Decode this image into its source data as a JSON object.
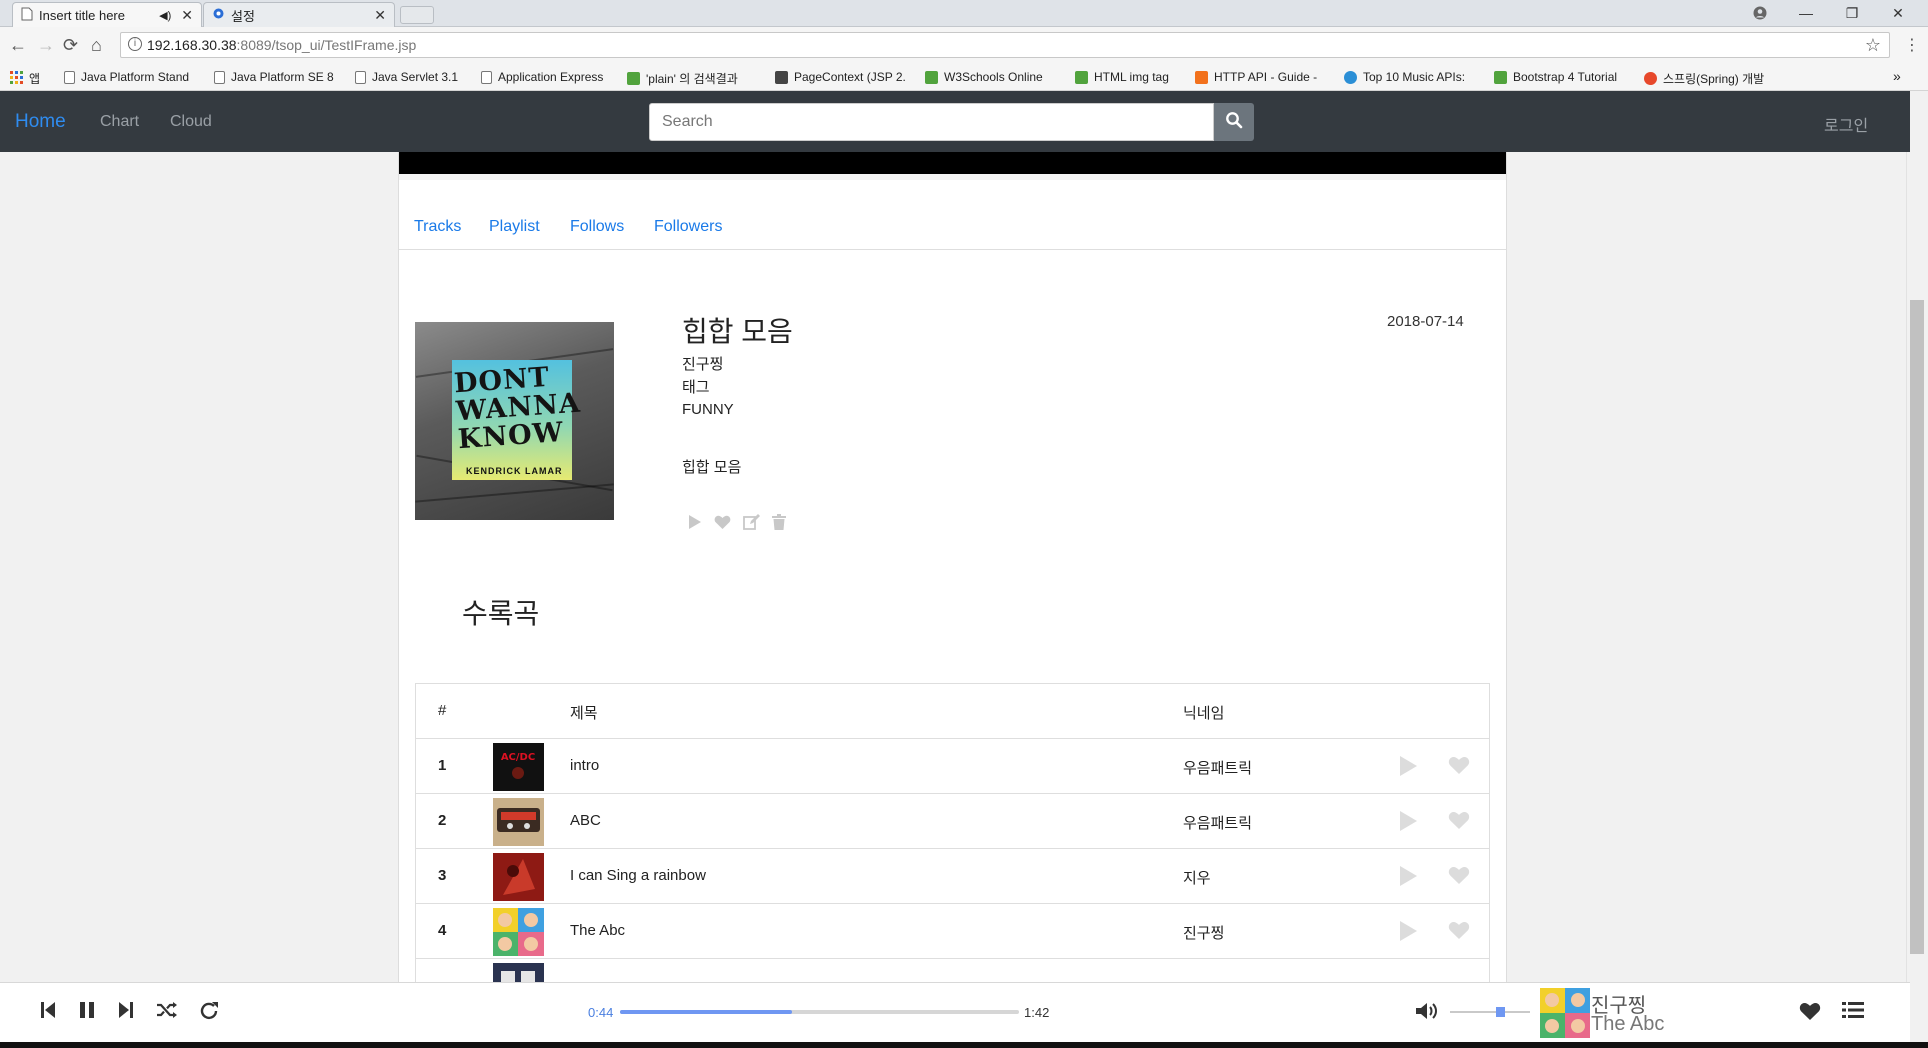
{
  "browser": {
    "tabs": [
      {
        "title": "Insert title here",
        "icon": "page-icon"
      },
      {
        "title": "설정",
        "icon": "gear-icon"
      }
    ],
    "url_host": "192.168.30.38",
    "url_path": ":8089/tsop_ui/TestIFrame.jsp",
    "bookmarks": [
      {
        "label": "앱",
        "icon": "apps-icon"
      },
      {
        "label": "Java Platform Stand",
        "icon": "page-icon"
      },
      {
        "label": "Java Platform SE 8",
        "icon": "page-icon"
      },
      {
        "label": "Java Servlet 3.1",
        "icon": "page-icon"
      },
      {
        "label": "Application Express",
        "icon": "page-icon"
      },
      {
        "label": "'plain' 의 검색결과",
        "icon": "naver-icon"
      },
      {
        "label": "PageContext (JSP 2.",
        "icon": "image-icon"
      },
      {
        "label": "W3Schools Online",
        "icon": "w3-icon"
      },
      {
        "label": "HTML img tag",
        "icon": "w3-icon"
      },
      {
        "label": "HTTP API - Guide -",
        "icon": "soundcloud-icon"
      },
      {
        "label": "Top 10 Music APIs:",
        "icon": "puzzle-icon"
      },
      {
        "label": "Bootstrap 4 Tutorial",
        "icon": "w3-icon"
      },
      {
        "label": "스프링(Spring) 개발",
        "icon": "tistory-icon"
      }
    ],
    "more_bookmarks": "»"
  },
  "navbar": {
    "brand": "Home",
    "links": [
      "Chart",
      "Cloud"
    ],
    "search_placeholder": "Search",
    "login": "로그인"
  },
  "profile_tabs": [
    "Tracks",
    "Playlist",
    "Follows",
    "Followers"
  ],
  "playlist": {
    "title": "힙합 모음",
    "date": "2018-07-14",
    "owner": "진구찡",
    "tag_label": "태그",
    "tag": "FUNNY",
    "description": "힙합 모음",
    "cover_text": "DONT WANNA KNOW",
    "cover_artist": "KENDRICK LAMAR"
  },
  "tracklist": {
    "section_title": "수록곡",
    "headers": {
      "num": "#",
      "title": "제목",
      "nickname": "닉네임"
    },
    "rows": [
      {
        "num": "1",
        "title": "intro",
        "nickname": "우음패트릭"
      },
      {
        "num": "2",
        "title": "ABC",
        "nickname": "우음패트릭"
      },
      {
        "num": "3",
        "title": "I can Sing a rainbow",
        "nickname": "지우"
      },
      {
        "num": "4",
        "title": "The Abc",
        "nickname": "진구찡"
      }
    ]
  },
  "player": {
    "current_time": "0:44",
    "total_time": "1:42",
    "progress": 0.43,
    "volume": 0.63,
    "now_playing_artist": "진구찡",
    "now_playing_title": "The Abc"
  },
  "colors": {
    "accent": "#1a7ae8",
    "navbar_bg": "#343a40",
    "progress": "#6f97f2"
  }
}
